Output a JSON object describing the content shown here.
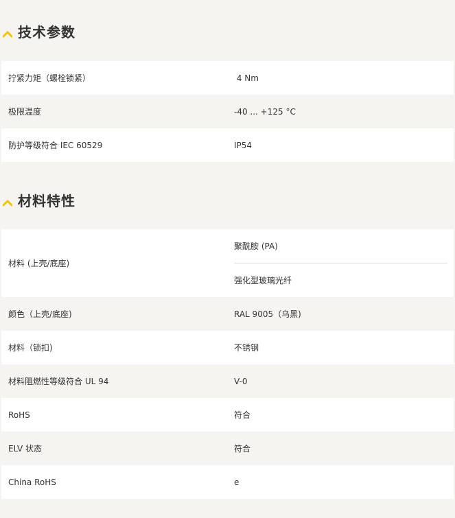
{
  "sections": [
    {
      "title": "技术参数",
      "rows": [
        {
          "label": "拧紧力矩（螺栓锁紧）",
          "value": " 4 Nm"
        },
        {
          "label": "极限温度",
          "value": "-40 ... +125 °C"
        },
        {
          "label": "防护等级符合 IEC 60529",
          "value": "IP54"
        }
      ]
    },
    {
      "title": "材料特性",
      "rows": [
        {
          "label": "材料 (上壳/底座)",
          "values": [
            "聚酰胺 (PA)",
            "强化型玻璃光纤"
          ]
        },
        {
          "label": "颜色（上壳/底座)",
          "value": "RAL 9005（乌黑)"
        },
        {
          "label": "材料（锁扣)",
          "value": "不锈钢"
        },
        {
          "label": "材料阻燃性等级符合 UL 94",
          "value": "V-0"
        },
        {
          "label": "RoHS",
          "value": "符合"
        },
        {
          "label": "ELV 状态",
          "value": "符合"
        },
        {
          "label": "China RoHS",
          "value": "e"
        }
      ]
    }
  ],
  "colors": {
    "accent": "#f5c400",
    "page_background": "#f5f4f0",
    "row_background": "#ffffff",
    "text": "#333333"
  },
  "icons": {
    "section_toggle": "chevron-up-icon"
  }
}
